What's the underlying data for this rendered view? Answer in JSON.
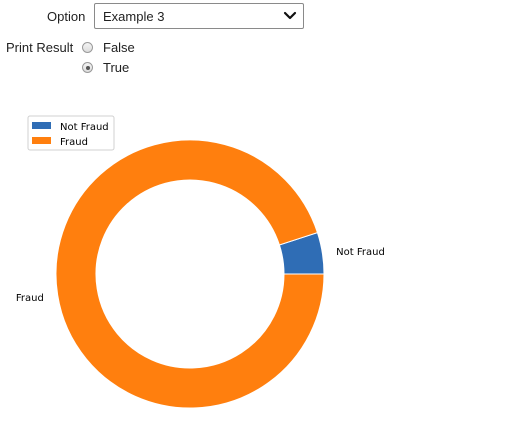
{
  "form": {
    "option_label": "Option",
    "option_selected": "Example 3",
    "print_label": "Print Result",
    "radio_options": [
      {
        "label": "False",
        "checked": false
      },
      {
        "label": "True",
        "checked": true
      }
    ]
  },
  "chart_data": {
    "type": "pie",
    "style": "donut",
    "categories": [
      "Not Fraud",
      "Fraud"
    ],
    "values": [
      5,
      95
    ],
    "colors": [
      "#2f6db5",
      "#ff7f0e"
    ],
    "legend": {
      "entries": [
        "Not Fraud",
        "Fraud"
      ],
      "placement": "top-left"
    },
    "slice_labels": [
      "Not Fraud",
      "Fraud"
    ]
  }
}
